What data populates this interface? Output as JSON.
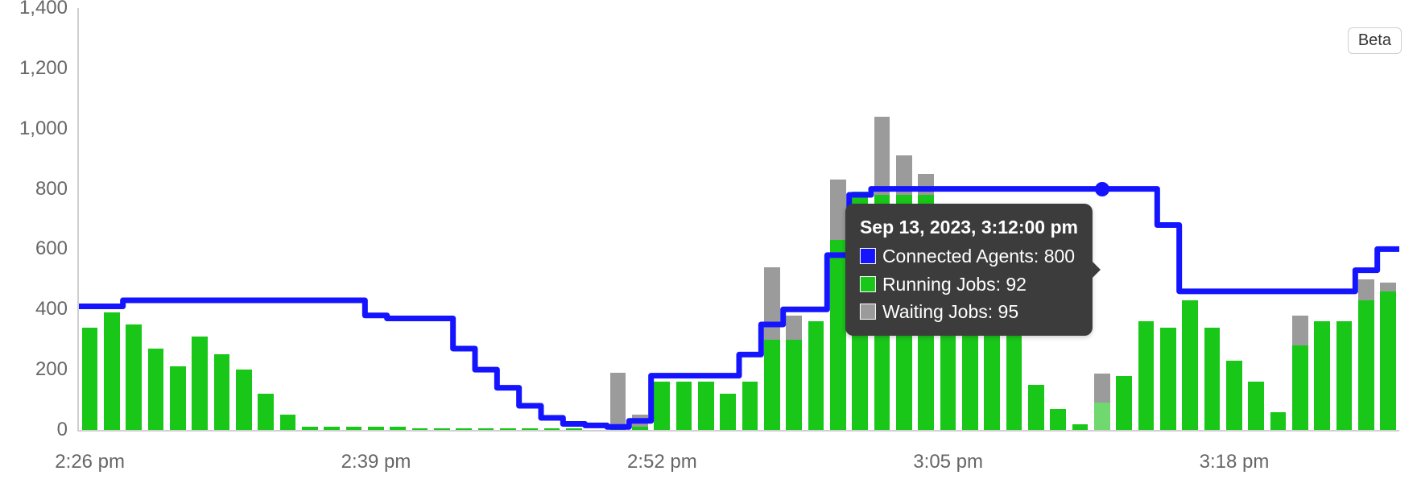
{
  "badge": {
    "label": "Beta"
  },
  "tooltip": {
    "timestamp": "Sep 13, 2023, 3:12:00 pm",
    "rows": [
      {
        "label": "Connected Agents",
        "value": 800,
        "color": "blue"
      },
      {
        "label": "Running Jobs",
        "value": 92,
        "color": "green"
      },
      {
        "label": "Waiting Jobs",
        "value": 95,
        "color": "gray"
      }
    ],
    "hover_index": 46
  },
  "chart_data": {
    "type": "bar+line",
    "ylim": [
      0,
      1400
    ],
    "y_ticks": [
      0,
      200,
      400,
      600,
      800,
      1000,
      1200,
      1400
    ],
    "x_tick_times": [
      "2:26 pm",
      "2:39 pm",
      "2:52 pm",
      "3:05 pm",
      "3:18 pm"
    ],
    "x_tick_indices": [
      0,
      13,
      26,
      39,
      52
    ],
    "times": [
      "2:26 pm",
      "2:27 pm",
      "2:28 pm",
      "2:29 pm",
      "2:30 pm",
      "2:31 pm",
      "2:32 pm",
      "2:33 pm",
      "2:34 pm",
      "2:35 pm",
      "2:36 pm",
      "2:37 pm",
      "2:38 pm",
      "2:39 pm",
      "2:40 pm",
      "2:41 pm",
      "2:42 pm",
      "2:43 pm",
      "2:44 pm",
      "2:45 pm",
      "2:46 pm",
      "2:47 pm",
      "2:48 pm",
      "2:49 pm",
      "2:50 pm",
      "2:51 pm",
      "2:52 pm",
      "2:53 pm",
      "2:54 pm",
      "2:55 pm",
      "2:56 pm",
      "2:57 pm",
      "2:58 pm",
      "2:59 pm",
      "3:00 pm",
      "3:01 pm",
      "3:02 pm",
      "3:03 pm",
      "3:04 pm",
      "3:05 pm",
      "3:06 pm",
      "3:07 pm",
      "3:08 pm",
      "3:09 pm",
      "3:10 pm",
      "3:11 pm",
      "3:12 pm",
      "3:13 pm",
      "3:14 pm",
      "3:15 pm",
      "3:16 pm",
      "3:17 pm",
      "3:18 pm",
      "3:19 pm",
      "3:20 pm",
      "3:21 pm",
      "3:22 pm",
      "3:23 pm",
      "3:24 pm",
      "3:25 pm"
    ],
    "series": [
      {
        "name": "Connected Agents",
        "kind": "line",
        "color": "#1414ff",
        "values": [
          410,
          410,
          430,
          430,
          430,
          430,
          430,
          430,
          430,
          430,
          430,
          430,
          430,
          380,
          370,
          370,
          370,
          270,
          200,
          140,
          80,
          40,
          20,
          15,
          10,
          30,
          180,
          180,
          180,
          180,
          250,
          350,
          400,
          400,
          580,
          780,
          800,
          800,
          800,
          800,
          800,
          800,
          800,
          800,
          800,
          800,
          800,
          800,
          800,
          680,
          460,
          460,
          460,
          460,
          460,
          460,
          460,
          460,
          530,
          600
        ]
      },
      {
        "name": "Running Jobs",
        "kind": "bar",
        "color": "#19c719",
        "values": [
          340,
          390,
          350,
          270,
          210,
          310,
          250,
          200,
          120,
          50,
          10,
          10,
          10,
          10,
          10,
          5,
          5,
          5,
          5,
          5,
          5,
          5,
          5,
          0,
          10,
          10,
          160,
          160,
          160,
          120,
          160,
          300,
          300,
          360,
          630,
          790,
          780,
          780,
          780,
          740,
          680,
          570,
          410,
          150,
          70,
          20,
          92,
          180,
          360,
          340,
          430,
          340,
          230,
          160,
          60,
          280,
          360,
          360,
          430,
          460
        ]
      },
      {
        "name": "Waiting Jobs",
        "kind": "bar",
        "color": "#9b9b9b",
        "values": [
          0,
          0,
          0,
          0,
          0,
          0,
          0,
          0,
          0,
          0,
          0,
          0,
          0,
          0,
          0,
          0,
          0,
          0,
          0,
          0,
          0,
          0,
          0,
          0,
          180,
          40,
          0,
          0,
          0,
          0,
          0,
          240,
          80,
          0,
          200,
          0,
          260,
          130,
          70,
          0,
          0,
          0,
          0,
          0,
          0,
          0,
          95,
          0,
          0,
          0,
          0,
          0,
          0,
          0,
          0,
          100,
          0,
          0,
          70,
          30
        ]
      }
    ]
  }
}
